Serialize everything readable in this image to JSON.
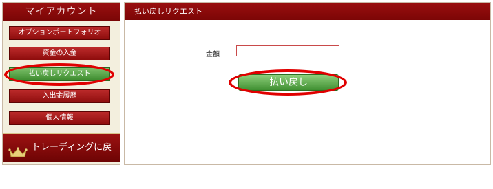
{
  "sidebar": {
    "title": "マイアカウント",
    "items": [
      {
        "label": "オプションポートフォリオ",
        "active": false
      },
      {
        "label": "資金の入金",
        "active": false
      },
      {
        "label": "払い戻しリクエスト",
        "active": true
      },
      {
        "label": "入出金履歴",
        "active": false
      },
      {
        "label": "個人情報",
        "active": false
      }
    ],
    "back_to_trading": "トレーディングに戻る",
    "back_icon": "crown-icon"
  },
  "main": {
    "title": "払い戻しリクエスト",
    "amount_label": "金額",
    "amount_value": "",
    "submit_label": "払い戻し"
  },
  "colors": {
    "header_red": "#8a0a0a",
    "button_green": "#4a9a3a",
    "highlight_ring": "#e00000",
    "sidebar_bg": "#f3efde"
  }
}
